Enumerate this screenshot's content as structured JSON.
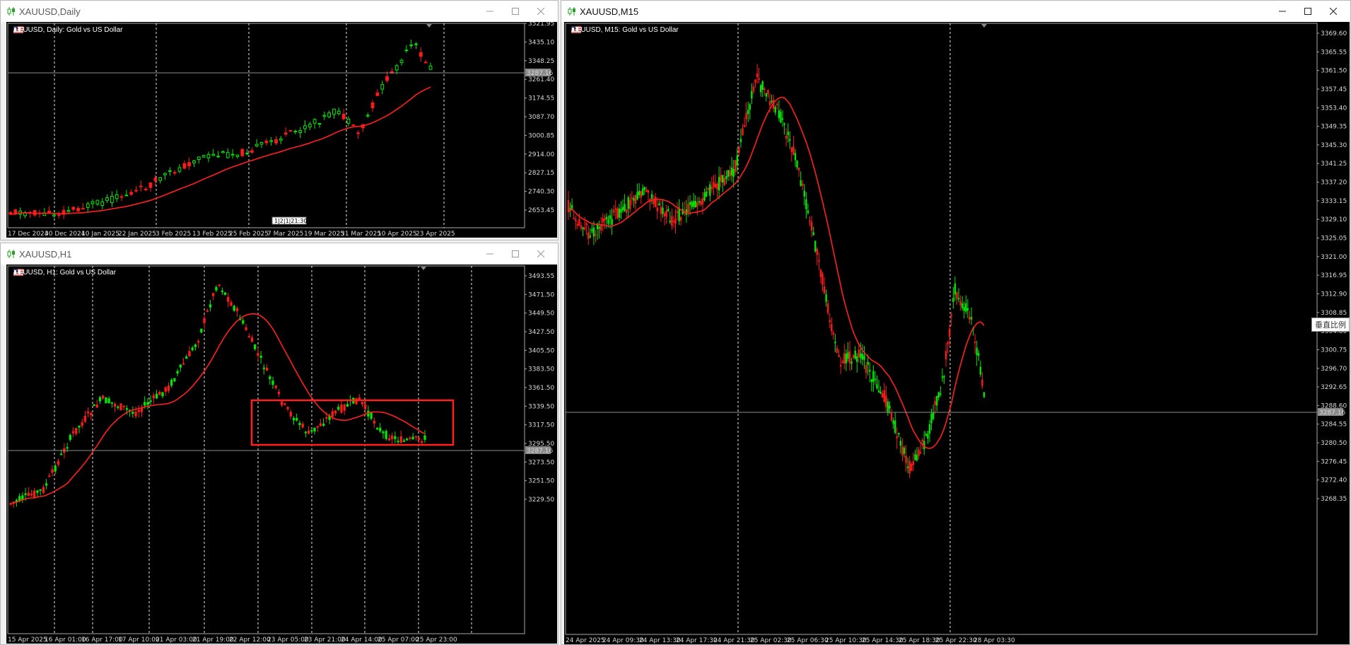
{
  "windows": [
    {
      "id": "daily",
      "title": "XAUUSD,Daily",
      "header": "XAUUSD, Daily:  Gold vs US Dollar",
      "price_axis": [
        "3521.95",
        "3435.10",
        "3348.25",
        "3261.40",
        "3174.55",
        "3087.70",
        "3000.85",
        "2914.00",
        "2827.15",
        "2740.30",
        "2653.45"
      ],
      "time_axis": [
        "17 Dec 2024",
        "30 Dec 2024",
        "10 Jan 2025",
        "22 Jan 2025",
        "3 Feb 2025",
        "13 Feb 2025",
        "25 Feb 2025",
        "7 Mar 2025",
        "19 Mar 2025",
        "31 Mar 2025",
        "10 Apr 2025",
        "23 Apr 2025"
      ],
      "current_price": "3287.16",
      "scroll_marker": "1|2|1|21:30"
    },
    {
      "id": "h1",
      "title": "XAUUSD,H1",
      "header": "XAUUSD, H1:  Gold vs US Dollar",
      "price_axis": [
        "3493.55",
        "3471.50",
        "3449.50",
        "3427.50",
        "3405.50",
        "3383.50",
        "3361.50",
        "3339.50",
        "3317.50",
        "3295.50",
        "3273.50",
        "3251.50",
        "3229.50"
      ],
      "time_axis": [
        "15 Apr 2025",
        "16 Apr 01:00",
        "16 Apr 17:00",
        "17 Apr 10:00",
        "21 Apr 03:00",
        "21 Apr 19:00",
        "22 Apr 12:00",
        "23 Apr 05:00",
        "23 Apr 21:00",
        "24 Apr 14:00",
        "25 Apr 07:00",
        "25 Apr 23:00"
      ],
      "current_price": "3287.16"
    },
    {
      "id": "m15",
      "title": "XAUUSD,M15",
      "header": "XAUUSD, M15:  Gold vs US Dollar",
      "price_axis": [
        "3369.60",
        "3365.55",
        "3361.50",
        "3357.45",
        "3353.40",
        "3349.35",
        "3345.30",
        "3341.25",
        "3337.20",
        "3333.15",
        "3329.10",
        "3325.05",
        "3321.00",
        "3316.95",
        "3312.90",
        "3308.85",
        "3304.80",
        "3300.75",
        "3296.70",
        "3292.65",
        "3288.60",
        "3284.55",
        "3280.50",
        "3276.45",
        "3272.40",
        "3268.35"
      ],
      "time_axis": [
        "24 Apr 2025",
        "24 Apr 09:30",
        "24 Apr 13:30",
        "24 Apr 17:30",
        "24 Apr 21:30",
        "25 Apr 02:30",
        "25 Apr 06:30",
        "25 Apr 10:30",
        "25 Apr 14:30",
        "25 Apr 18:30",
        "25 Apr 22:30",
        "28 Apr 03:30"
      ],
      "current_price": "3287.16",
      "tooltip": "垂直比例"
    }
  ],
  "colors": {
    "bull": "#00e600",
    "bear": "#ff1a1a",
    "ma": "#ff2020",
    "grid": "#ffffff",
    "bid_line": "#8c8c8c",
    "rect": "#ff2020"
  },
  "icons": {
    "window": "candlestick-icon",
    "flag": "us-flag-icon",
    "minimize": "minimize-icon",
    "maximize": "maximize-icon",
    "close": "close-icon"
  }
}
